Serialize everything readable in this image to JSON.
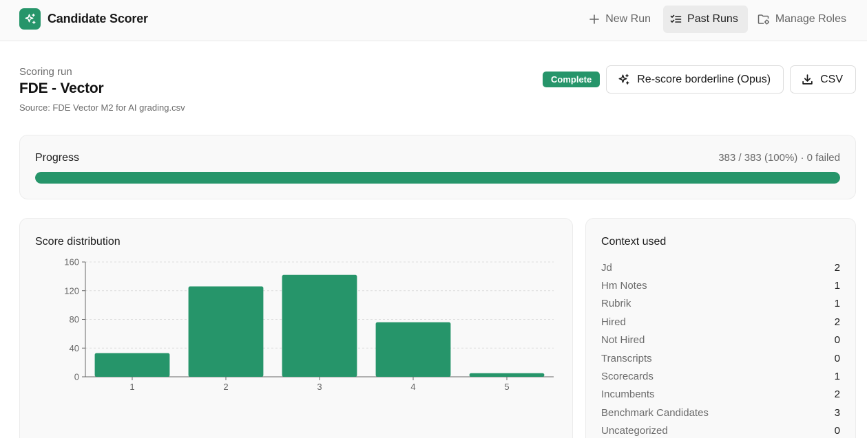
{
  "app": {
    "name": "Candidate Scorer"
  },
  "nav": [
    {
      "label": "New Run",
      "icon": "plus-icon",
      "active": false
    },
    {
      "label": "Past Runs",
      "icon": "checklist-icon",
      "active": true
    },
    {
      "label": "Manage Roles",
      "icon": "folder-gear-icon",
      "active": false
    }
  ],
  "run": {
    "kicker": "Scoring run",
    "title": "FDE - Vector",
    "source": "Source: FDE Vector M2 for AI grading.csv",
    "status": "Complete",
    "rescore_label": "Re-score borderline (Opus)",
    "csv_label": "CSV"
  },
  "progress": {
    "title": "Progress",
    "stat": "383 / 383 (100%) · 0 failed",
    "fraction": 1.0
  },
  "score_panel": {
    "title": "Score distribution"
  },
  "chart_data": {
    "type": "bar",
    "title": "",
    "xlabel": "",
    "ylabel": "",
    "categories": [
      "1",
      "2",
      "3",
      "4",
      "5"
    ],
    "values": [
      33,
      126,
      142,
      76,
      5
    ],
    "ylim": [
      0,
      160
    ],
    "yticks": [
      0,
      40,
      80,
      120,
      160
    ],
    "grid": true,
    "color": "#26956a"
  },
  "context": {
    "title": "Context used",
    "items": [
      {
        "label": "Jd",
        "value": "2"
      },
      {
        "label": "Hm Notes",
        "value": "1"
      },
      {
        "label": "Rubrik",
        "value": "1"
      },
      {
        "label": "Hired",
        "value": "2"
      },
      {
        "label": "Not Hired",
        "value": "0"
      },
      {
        "label": "Transcripts",
        "value": "0"
      },
      {
        "label": "Scorecards",
        "value": "1"
      },
      {
        "label": "Incumbents",
        "value": "2"
      },
      {
        "label": "Benchmark Candidates",
        "value": "3"
      },
      {
        "label": "Uncategorized",
        "value": "0"
      }
    ]
  },
  "colors": {
    "accent": "#26956a",
    "muted": "#6b6b6b"
  }
}
